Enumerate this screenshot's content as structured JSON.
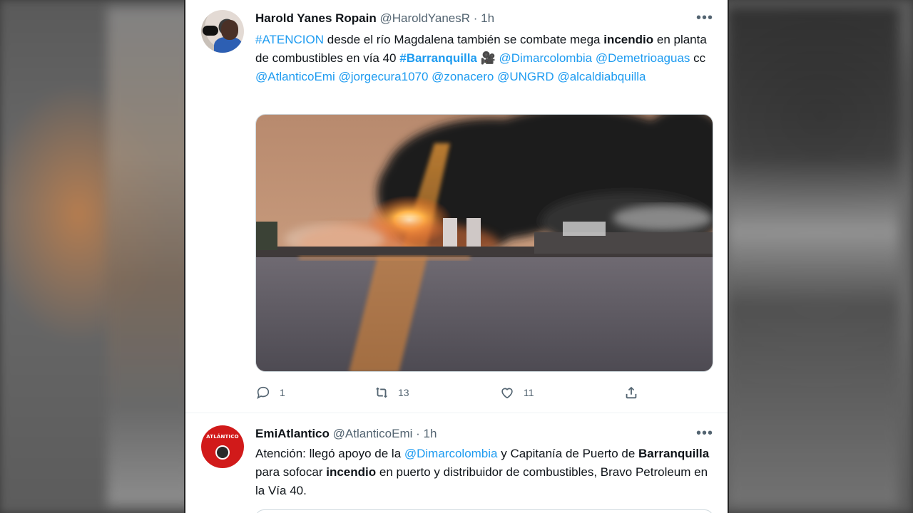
{
  "tweets": [
    {
      "author_name": "Harold Yanes Ropain",
      "handle": "@HaroldYanesR",
      "separator": "·",
      "time": "1h",
      "text_runs": [
        {
          "t": "#ATENCION",
          "s": "link"
        },
        {
          "t": " desde el río Magdalena también se combate mega ",
          "s": ""
        },
        {
          "t": "incendio",
          "s": "bold"
        },
        {
          "t": " en planta de combustibles en vía 40 ",
          "s": ""
        },
        {
          "t": "#Barranquilla",
          "s": "link bold"
        },
        {
          "t": " 🎥 ",
          "s": ""
        },
        {
          "t": "@Dimarcolombia",
          "s": "link"
        },
        {
          "t": " ",
          "s": ""
        },
        {
          "t": "@Demetrioaguas",
          "s": "link"
        },
        {
          "t": " cc ",
          "s": ""
        },
        {
          "t": "@AtlanticoEmi",
          "s": "link"
        },
        {
          "t": " ",
          "s": ""
        },
        {
          "t": "@jorgecura1070",
          "s": "link"
        },
        {
          "t": " ",
          "s": ""
        },
        {
          "t": "@zonacero",
          "s": "link"
        },
        {
          "t": " ",
          "s": ""
        },
        {
          "t": "@UNGRD",
          "s": "link"
        },
        {
          "t": " ",
          "s": ""
        },
        {
          "t": "@alcaldiabquilla",
          "s": "link"
        }
      ],
      "replies": "1",
      "retweets": "13",
      "likes": "11"
    },
    {
      "author_name": "EmiAtlantico",
      "handle": "@AtlanticoEmi",
      "separator": "·",
      "time": "1h",
      "avatar_text": "ATLÁNTICO",
      "text_runs": [
        {
          "t": "Atención: llegó apoyo de la ",
          "s": ""
        },
        {
          "t": "@Dimarcolombia",
          "s": "link"
        },
        {
          "t": " y Capitanía de Puerto de ",
          "s": ""
        },
        {
          "t": "Barranquilla",
          "s": "bold"
        },
        {
          "t": " para sofocar ",
          "s": ""
        },
        {
          "t": "incendio",
          "s": "bold"
        },
        {
          "t": " en puerto y distribuidor de combustibles, Bravo Petroleum en la Vía 40.",
          "s": ""
        }
      ]
    }
  ],
  "more_icon": "more-horizontal-icon",
  "icons": {
    "reply": "reply-icon",
    "retweet": "retweet-icon",
    "like": "heart-icon",
    "share": "share-icon",
    "video": "video-camera-emoji"
  },
  "colors": {
    "link": "#1d9bf0",
    "text": "#0f1419",
    "muted": "#536471",
    "avatar_red": "#d11a1a"
  }
}
